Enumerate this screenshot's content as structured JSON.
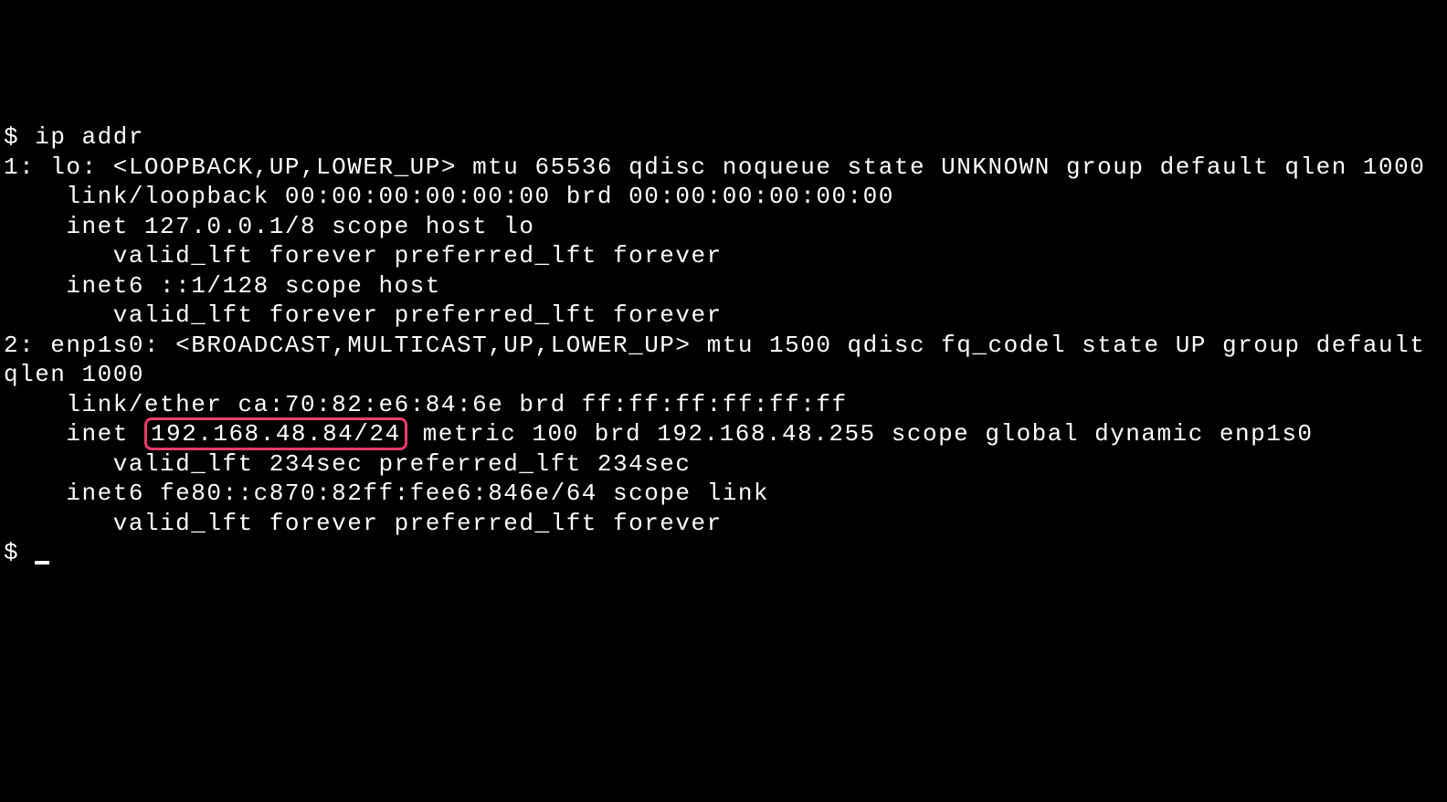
{
  "prompt1": "$ ",
  "command": "ip addr",
  "iface1_header": "1: lo: <LOOPBACK,UP,LOWER_UP> mtu 65536 qdisc noqueue state UNKNOWN group default qlen 1000",
  "iface1_link": "    link/loopback 00:00:00:00:00:00 brd 00:00:00:00:00:00",
  "iface1_inet": "    inet 127.0.0.1/8 scope host lo",
  "iface1_valid1": "       valid_lft forever preferred_lft forever",
  "iface1_inet6": "    inet6 ::1/128 scope host",
  "iface1_valid2": "       valid_lft forever preferred_lft forever",
  "iface2_header": "2: enp1s0: <BROADCAST,MULTICAST,UP,LOWER_UP> mtu 1500 qdisc fq_codel state UP group default qlen 1000",
  "iface2_link": "    link/ether ca:70:82:e6:84:6e brd ff:ff:ff:ff:ff:ff",
  "iface2_inet_prefix": "    inet ",
  "iface2_inet_highlighted": "192.168.48.84/24",
  "iface2_inet_suffix": " metric 100 brd 192.168.48.255 scope global dynamic enp1s0",
  "iface2_valid1": "       valid_lft 234sec preferred_lft 234sec",
  "iface2_inet6": "    inet6 fe80::c870:82ff:fee6:846e/64 scope link",
  "iface2_valid2": "       valid_lft forever preferred_lft forever",
  "prompt2": "$ "
}
